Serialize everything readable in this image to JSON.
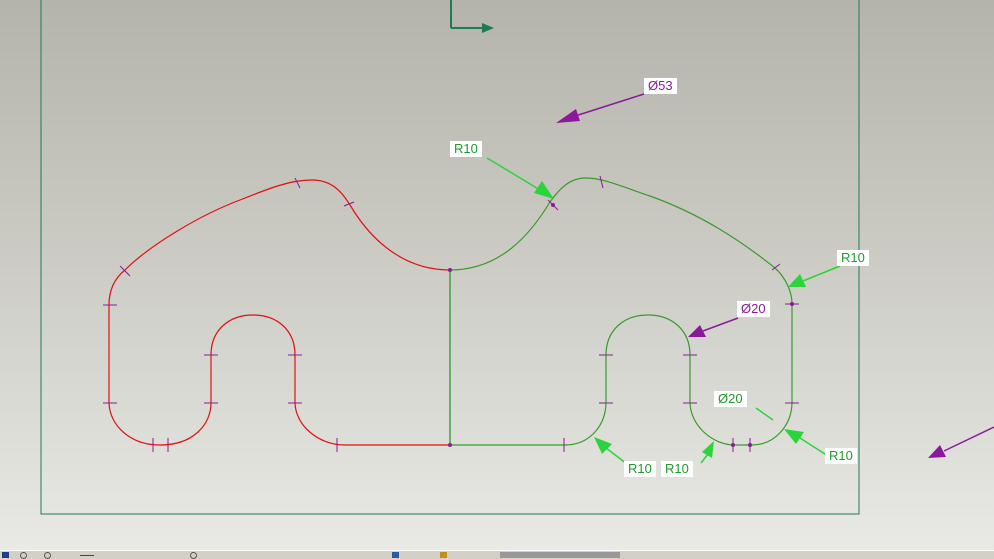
{
  "colors": {
    "frame": "#1e7a50",
    "constrained_curve": "#3a9a2c",
    "unconstrained_curve": "#e01010",
    "dimension_magenta": "#8a1a9a",
    "dimension_green": "#2bd43a",
    "axis": "#1e7a50"
  },
  "dimensions": [
    {
      "id": "dia53",
      "text": "Ø53",
      "color": "magenta"
    },
    {
      "id": "r10_top",
      "text": "R10",
      "color": "green"
    },
    {
      "id": "r10_right",
      "text": "R10",
      "color": "green"
    },
    {
      "id": "dia20_magenta",
      "text": "Ø20",
      "color": "magenta"
    },
    {
      "id": "dia20_green",
      "text": "Ø20",
      "color": "green"
    },
    {
      "id": "r10_bottom_left",
      "text": "R10",
      "color": "green"
    },
    {
      "id": "r10_bottom_mid",
      "text": "R10",
      "color": "green"
    },
    {
      "id": "r10_bottom_right",
      "text": "R10",
      "color": "green"
    }
  ],
  "toolbar": {
    "icons": [
      "view-icon",
      "zoom-icon",
      "pan-icon",
      "rotate-icon",
      "render-icon",
      "layer-icon",
      "save-icon",
      "settings-icon"
    ]
  }
}
